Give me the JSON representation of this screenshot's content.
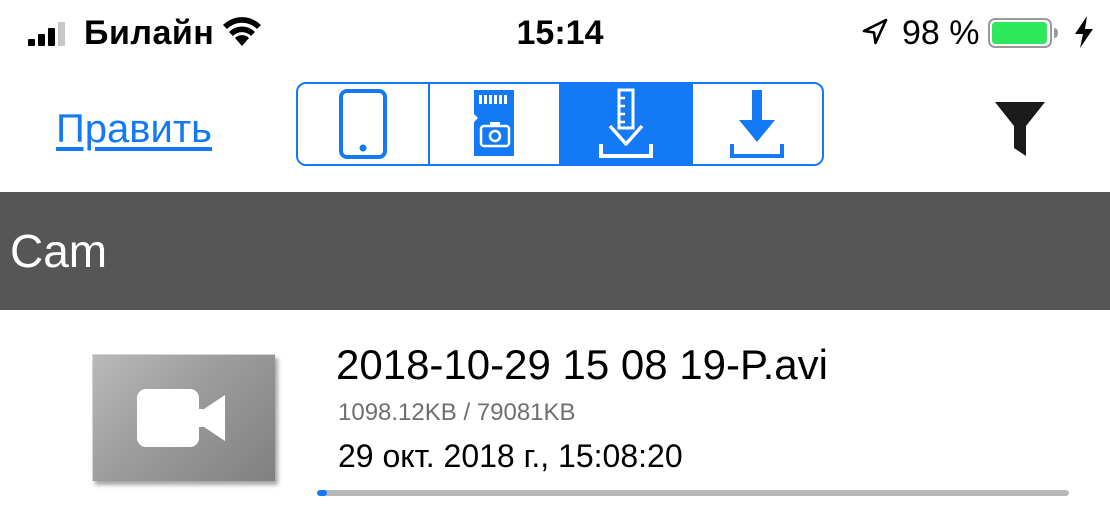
{
  "status_bar": {
    "carrier": "Билайн",
    "time": "15:14",
    "battery_percent": "98 %",
    "battery_level": 0.98,
    "icons": [
      "signal-icon",
      "wifi-icon",
      "location-arrow-icon",
      "battery-icon",
      "charging-bolt-icon"
    ]
  },
  "toolbar": {
    "edit_label": "Править",
    "segments": [
      {
        "icon": "phone-icon",
        "selected": false
      },
      {
        "icon": "sd-card-camera-icon",
        "selected": false
      },
      {
        "icon": "film-download-icon",
        "selected": true
      },
      {
        "icon": "download-icon",
        "selected": false
      }
    ],
    "filter_icon": "filter-icon"
  },
  "section": {
    "title": "Cam"
  },
  "files": [
    {
      "name": "2018-10-29 15 08 19-P.avi",
      "size": "1098.12KB / 79081KB",
      "date": "29 окт. 2018 г., 15:08:20",
      "progress": 0.0139,
      "thumbnail_icon": "video-camera-icon"
    }
  ],
  "colors": {
    "accent": "#1479f5",
    "section_header_bg": "#565656",
    "battery_fill": "#2ee85c",
    "progress_track": "#b8b8b8",
    "secondary_text": "#6f6f6f"
  }
}
